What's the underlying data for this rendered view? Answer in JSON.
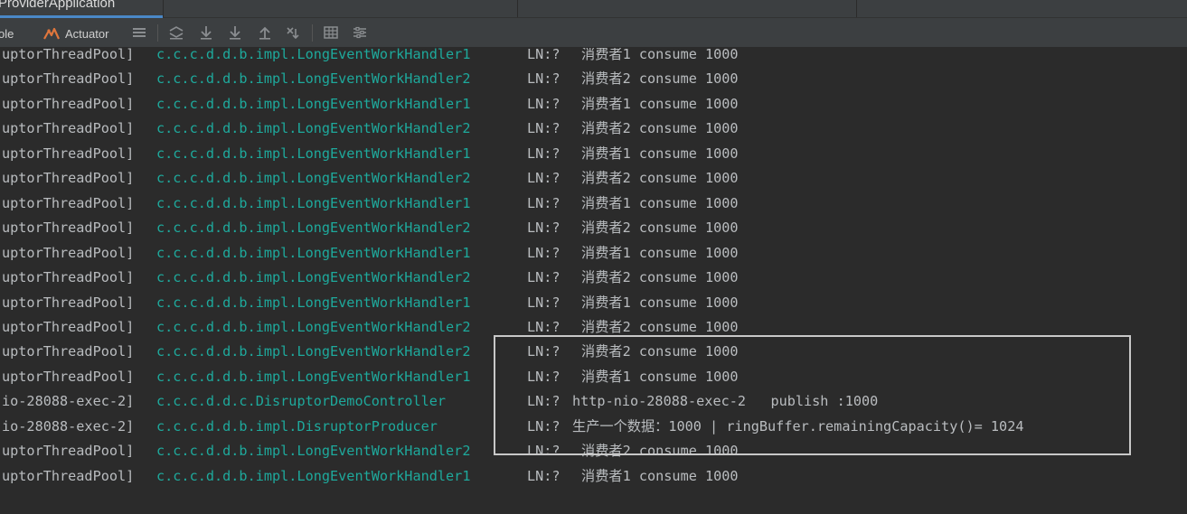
{
  "tabs": {
    "run_config": "ProviderApplication"
  },
  "toolbar": {
    "console_label": "ole",
    "actuator_label": "Actuator",
    "icons": [
      "menu-icon",
      "scroll-to-top-icon",
      "download-icon",
      "download-icon",
      "upload-icon",
      "clear-icon",
      "table-icon",
      "settings-icon"
    ]
  },
  "console": {
    "lines": [
      {
        "thread": "uptorThreadPool]",
        "logger": "c.c.c.d.d.b.impl.LongEventWorkHandler1",
        "ln": "LN:?",
        "msg": "消费者1 consume 1000"
      },
      {
        "thread": "uptorThreadPool]",
        "logger": "c.c.c.d.d.b.impl.LongEventWorkHandler2",
        "ln": "LN:?",
        "msg": "消费者2 consume 1000"
      },
      {
        "thread": "uptorThreadPool]",
        "logger": "c.c.c.d.d.b.impl.LongEventWorkHandler1",
        "ln": "LN:?",
        "msg": "消费者1 consume 1000"
      },
      {
        "thread": "uptorThreadPool]",
        "logger": "c.c.c.d.d.b.impl.LongEventWorkHandler2",
        "ln": "LN:?",
        "msg": "消费者2 consume 1000"
      },
      {
        "thread": "uptorThreadPool]",
        "logger": "c.c.c.d.d.b.impl.LongEventWorkHandler1",
        "ln": "LN:?",
        "msg": "消费者1 consume 1000"
      },
      {
        "thread": "uptorThreadPool]",
        "logger": "c.c.c.d.d.b.impl.LongEventWorkHandler2",
        "ln": "LN:?",
        "msg": "消费者2 consume 1000"
      },
      {
        "thread": "uptorThreadPool]",
        "logger": "c.c.c.d.d.b.impl.LongEventWorkHandler1",
        "ln": "LN:?",
        "msg": "消费者1 consume 1000"
      },
      {
        "thread": "uptorThreadPool]",
        "logger": "c.c.c.d.d.b.impl.LongEventWorkHandler2",
        "ln": "LN:?",
        "msg": "消费者2 consume 1000"
      },
      {
        "thread": "uptorThreadPool]",
        "logger": "c.c.c.d.d.b.impl.LongEventWorkHandler1",
        "ln": "LN:?",
        "msg": "消费者1 consume 1000"
      },
      {
        "thread": "uptorThreadPool]",
        "logger": "c.c.c.d.d.b.impl.LongEventWorkHandler2",
        "ln": "LN:?",
        "msg": "消费者2 consume 1000"
      },
      {
        "thread": "uptorThreadPool]",
        "logger": "c.c.c.d.d.b.impl.LongEventWorkHandler1",
        "ln": "LN:?",
        "msg": "消费者1 consume 1000"
      },
      {
        "thread": "uptorThreadPool]",
        "logger": "c.c.c.d.d.b.impl.LongEventWorkHandler2",
        "ln": "LN:?",
        "msg": "消费者2 consume 1000"
      },
      {
        "thread": "uptorThreadPool]",
        "logger": "c.c.c.d.d.b.impl.LongEventWorkHandler2",
        "ln": "LN:?",
        "msg": "消费者2 consume 1000"
      },
      {
        "thread": "uptorThreadPool]",
        "logger": "c.c.c.d.d.b.impl.LongEventWorkHandler1",
        "ln": "LN:?",
        "msg": "消费者1 consume 1000"
      },
      {
        "thread": "io-28088-exec-2]",
        "logger": "c.c.c.d.d.c.DisruptorDemoController",
        "ln": "LN:?",
        "msg": "http-nio-28088-exec-2   publish :1000"
      },
      {
        "thread": "io-28088-exec-2]",
        "logger": "c.c.c.d.d.b.impl.DisruptorProducer",
        "ln": "LN:?",
        "msg": "生产一个数据：1000 | ringBuffer.remainingCapacity()= 1024"
      },
      {
        "thread": "uptorThreadPool]",
        "logger": "c.c.c.d.d.b.impl.LongEventWorkHandler2",
        "ln": "LN:?",
        "msg": "消费者2 consume 1000"
      },
      {
        "thread": "uptorThreadPool]",
        "logger": "c.c.c.d.d.b.impl.LongEventWorkHandler1",
        "ln": "LN:?",
        "msg": "消费者1 consume 1000"
      }
    ]
  }
}
